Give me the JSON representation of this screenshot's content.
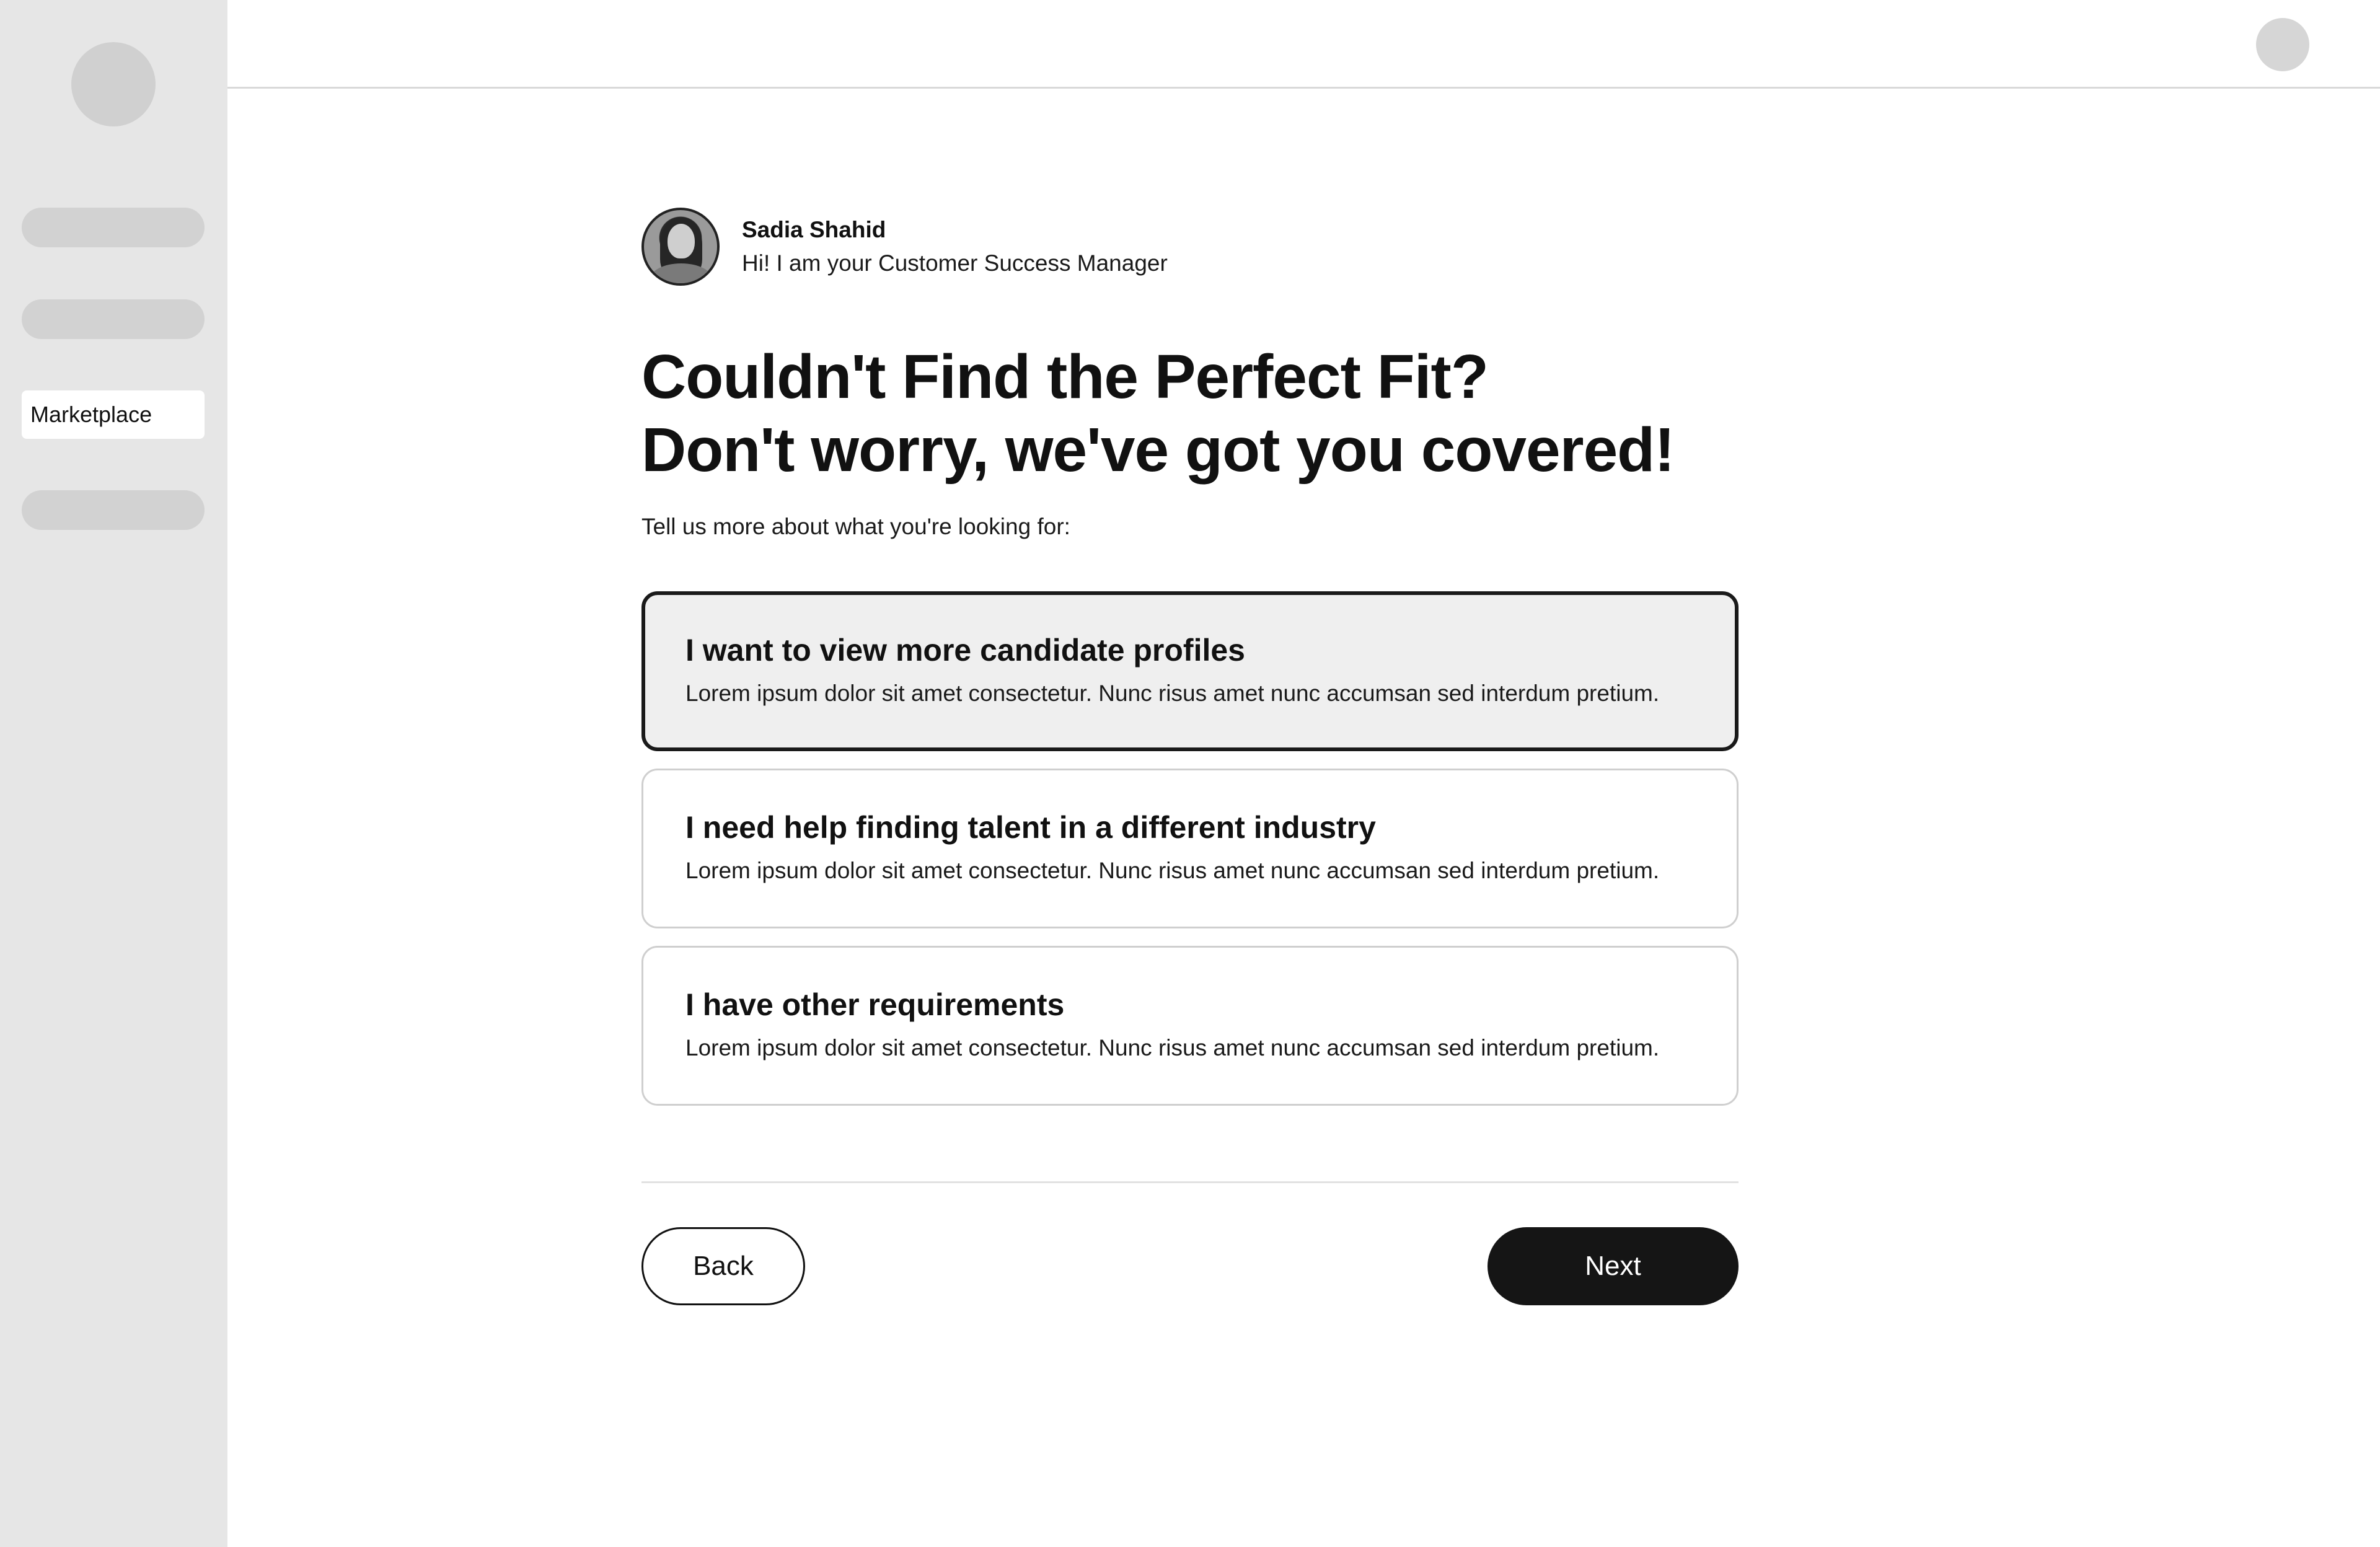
{
  "sidebar": {
    "active_item_label": "Marketplace"
  },
  "manager": {
    "name": "Sadia Shahid",
    "role": "Hi! I am your Customer Success Manager"
  },
  "headline": {
    "line1": "Couldn't Find the Perfect Fit?",
    "line2": "Don't worry, we've got you covered!"
  },
  "subtext": "Tell us more about what you're looking for:",
  "options": [
    {
      "title": "I want to view more candidate profiles",
      "description": "Lorem ipsum dolor sit amet consectetur. Nunc risus amet nunc accumsan sed interdum pretium.",
      "selected": true
    },
    {
      "title": "I need help finding talent in a different industry",
      "description": "Lorem ipsum dolor sit amet consectetur. Nunc risus amet nunc accumsan sed interdum pretium.",
      "selected": false
    },
    {
      "title": "I have other requirements",
      "description": "Lorem ipsum dolor sit amet consectetur. Nunc risus amet nunc accumsan sed interdum pretium.",
      "selected": false
    }
  ],
  "actions": {
    "back_label": "Back",
    "next_label": "Next"
  },
  "colors": {
    "sidebar_bg": "#e6e6e6",
    "primary_button": "#151515",
    "selected_option_bg": "#efefef"
  }
}
